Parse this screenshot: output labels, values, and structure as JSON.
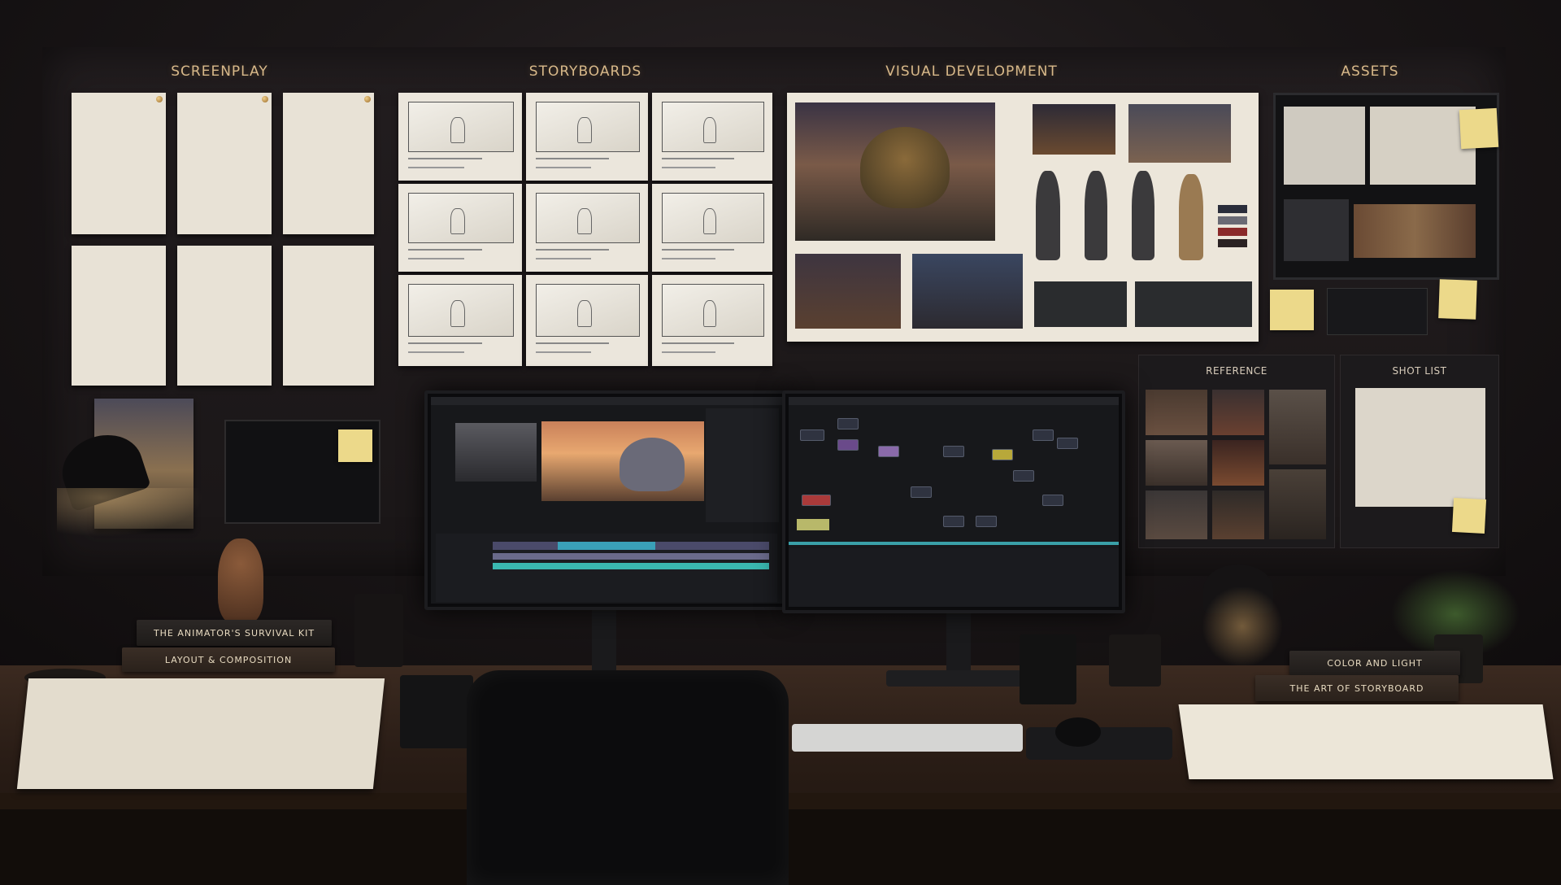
{
  "wall": {
    "sections": {
      "screenplay": "SCREENPLAY",
      "storyboards": "STORYBOARDS",
      "visual_development": "VISUAL DEVELOPMENT",
      "assets": "ASSETS"
    },
    "panels": {
      "reference": "REFERENCE",
      "shot_list": "SHOT LIST"
    }
  },
  "desk": {
    "books_left": [
      "THE ANIMATOR'S SURVIVAL KIT",
      "LAYOUT & COMPOSITION"
    ],
    "books_right": [
      "COLOR AND LIGHT",
      "THE ART OF STORYBOARD"
    ]
  },
  "colors": {
    "accent_gold": "#d8b98a",
    "wall": "#1b1718",
    "desk_wood": "#3b2a20"
  }
}
